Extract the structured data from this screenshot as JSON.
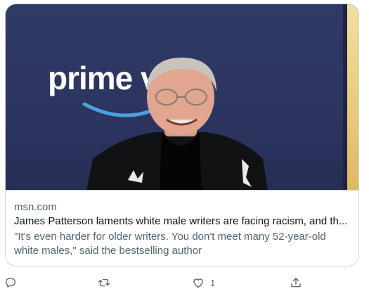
{
  "card": {
    "domain": "msn.com",
    "title": "James Patterson laments white male writers are facing racism, and th...",
    "description": "\"It's even harder for older writers. You don't meet many 52-year-old white males,\" said the bestselling author",
    "image_backdrop_text": "prime vi"
  },
  "actions": {
    "reply_icon": "reply-icon",
    "retweet_icon": "retweet-icon",
    "like_icon": "heart-icon",
    "like_count": "1",
    "share_icon": "share-icon"
  },
  "colors": {
    "border": "#cfd9de",
    "secondary_text": "#536471",
    "primary_text": "#0f1419",
    "backdrop": "#2c3560"
  }
}
